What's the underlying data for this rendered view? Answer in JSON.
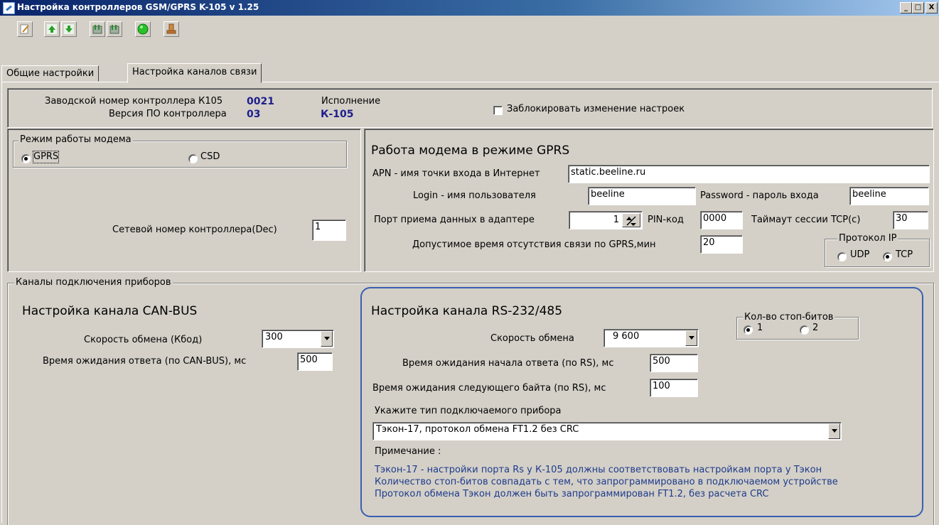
{
  "window": {
    "title": "Настройка контроллеров GSM/GPRS K-105   v 1.25",
    "minimize": "_",
    "maximize": "□",
    "close": "X"
  },
  "toolbar": [
    "edit-icon",
    "arrow-up-icon",
    "arrow-down-icon",
    "device-in-icon",
    "device-out-icon",
    "green-circle-icon",
    "stamp-icon"
  ],
  "tabs": [
    {
      "label": "Общие настройки",
      "active": false
    },
    {
      "label": "Настройка каналов связи",
      "active": true
    }
  ],
  "info": {
    "serial_label": "Заводской номер контроллера К105",
    "serial_value": "0021",
    "firmware_label": "Версия ПО контроллера",
    "firmware_value": "03",
    "variant_label": "Исполнение",
    "variant_value": "К-105",
    "lock_label": "Заблокировать изменение настроек",
    "lock_checked": false
  },
  "modem_mode": {
    "legend": "Режим работы модема",
    "options": [
      {
        "label": "GPRS",
        "selected": true
      },
      {
        "label": "CSD",
        "selected": false
      }
    ],
    "net_number_label": "Сетевой номер контроллера(Dec)",
    "net_number_value": "1"
  },
  "gprs": {
    "title": "Работа модема в режиме GPRS",
    "apn_label": "APN - имя точки входа в Интернет",
    "apn_value": "static.beeline.ru",
    "login_label": "Login - имя пользователя",
    "login_value": "beeline",
    "password_label": "Password  - пароль входа",
    "password_value": "beeline",
    "port_label": "Порт приема данных в адаптере",
    "port_value": "1",
    "pin_label": "PIN-код",
    "pin_value": "0000",
    "timeout_label": "Таймаут сессии TCP(c)",
    "timeout_value": "30",
    "allowed_label": "Допустимое время отсутствия связи по GPRS,мин",
    "allowed_value": "20",
    "protocol_legend": "Протокол IP",
    "protocol_options": [
      {
        "label": "UDP",
        "selected": false
      },
      {
        "label": "TCP",
        "selected": true
      }
    ]
  },
  "channels": {
    "legend": "Каналы подключения приборов",
    "can": {
      "title": "Настройка  канала CAN-BUS",
      "speed_label": "Скорость обмена (Кбод)",
      "speed_value": "300",
      "wait_label": "Время ожидания ответа (по CAN-BUS), мс",
      "wait_value": "500"
    },
    "rs": {
      "title": "Настройка канала RS-232/485",
      "speed_label": "Скорость обмена",
      "speed_value": "9 600",
      "stopbits_legend": "Кол-во стоп-битов",
      "stopbits_options": [
        {
          "label": "1",
          "selected": true
        },
        {
          "label": "2",
          "selected": false
        }
      ],
      "wait_start_label": "Время ожидания начала ответа (по RS), мс",
      "wait_start_value": "500",
      "wait_next_label": "Время ожидания следующего байта (по RS), мс",
      "wait_next_value": "100",
      "device_label": "Укажите тип подключаемого прибора",
      "device_value": "Тэкон-17, протокол обмена FT1.2 без CRC",
      "note_label": "Примечание :",
      "note_lines": [
        "Тэкон-17 - настройки порта Rs у К-105 должны соответствовать настройкам порта у Тэкон",
        "Количество стоп-битов совпадать с тем, что запрограммировано в подключаемом устройстве",
        "Протокол обмена Тэкон должен быть запрограммирован FT1.2, без расчета CRC"
      ]
    }
  },
  "colors": {
    "value_blue": "#1e1e8c",
    "note_blue": "#1e3c8c",
    "highlight_border": "#3a5fb0"
  }
}
